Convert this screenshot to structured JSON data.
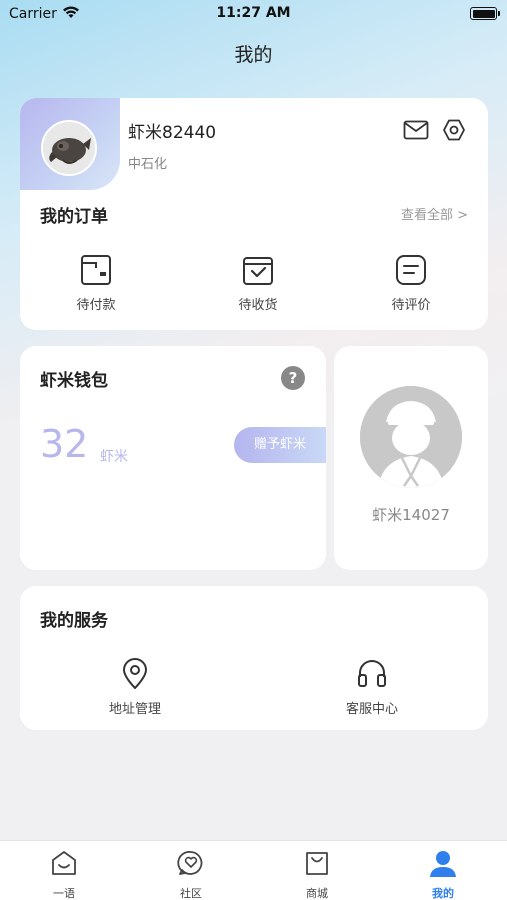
{
  "status_bar": {
    "carrier": "Carrier",
    "time": "11:27 AM"
  },
  "header": {
    "title": "我的"
  },
  "profile": {
    "username": "虾米82440",
    "company": "中石化",
    "mail_icon": "mail-icon",
    "settings_icon": "settings-icon"
  },
  "orders": {
    "title": "我的订单",
    "view_all": "查看全部 >",
    "items": [
      {
        "label": "待付款",
        "icon": "wallet-icon"
      },
      {
        "label": "待收货",
        "icon": "delivery-box-icon"
      },
      {
        "label": "待评价",
        "icon": "review-note-icon"
      }
    ]
  },
  "wallet": {
    "title": "虾米钱包",
    "help": "?",
    "amount": "32",
    "unit": "虾米",
    "gift_button": "赠予虾米"
  },
  "friend": {
    "name": "虾米14027"
  },
  "services": {
    "title": "我的服务",
    "items": [
      {
        "label": "地址管理",
        "icon": "location-pin-icon"
      },
      {
        "label": "客服中心",
        "icon": "headset-icon"
      }
    ]
  },
  "tab_bar": {
    "active_color": "#2f80ed",
    "tabs": [
      {
        "label": "一语",
        "icon": "home-icon"
      },
      {
        "label": "社区",
        "icon": "community-icon"
      },
      {
        "label": "商城",
        "icon": "shopping-bag-icon"
      },
      {
        "label": "我的",
        "icon": "person-icon",
        "active": true
      }
    ]
  }
}
